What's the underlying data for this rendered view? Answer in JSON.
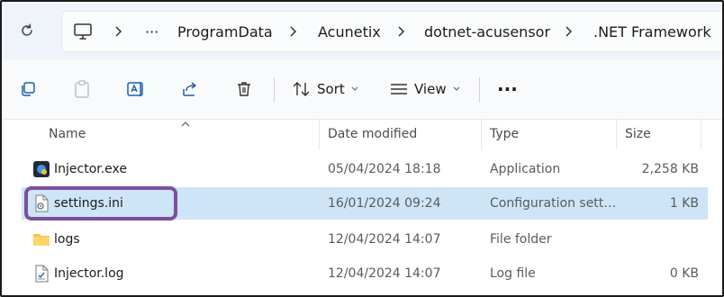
{
  "address": {
    "breadcrumbs": [
      "ProgramData",
      "Acunetix",
      "dotnet-acusensor",
      ".NET Framework"
    ],
    "more_label": "···"
  },
  "commands": {
    "sort_label": "Sort",
    "view_label": "View",
    "more_label": "···"
  },
  "columns": {
    "name": "Name",
    "date": "Date modified",
    "type": "Type",
    "size": "Size"
  },
  "files": [
    {
      "name": "Injector.exe",
      "date": "05/04/2024 18:18",
      "type": "Application",
      "size": "2,258 KB",
      "icon": "exe-icon"
    },
    {
      "name": "settings.ini",
      "date": "16/01/2024 09:24",
      "type": "Configuration sett…",
      "size": "1 KB",
      "icon": "ini-file-icon",
      "selected": true
    },
    {
      "name": "logs",
      "date": "12/04/2024 14:07",
      "type": "File folder",
      "size": "",
      "icon": "folder-icon"
    },
    {
      "name": "Injector.log",
      "date": "12/04/2024 14:07",
      "type": "Log file",
      "size": "0 KB",
      "icon": "log-file-icon"
    }
  ],
  "colors": {
    "selection": "#cde5f7",
    "highlight": "#7d4f9f",
    "folder": "#f4c542"
  }
}
